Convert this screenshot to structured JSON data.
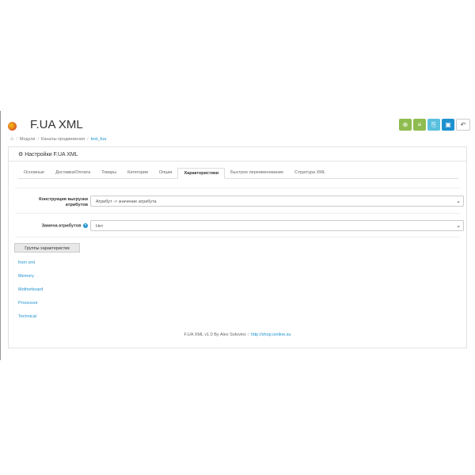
{
  "header": {
    "title": "F.UA XML",
    "buttons": [
      {
        "name": "add",
        "glyph": "⊕",
        "color": "#8fbc50"
      },
      {
        "name": "list",
        "glyph": "≡",
        "color": "#8fbc50"
      },
      {
        "name": "export",
        "glyph": "⎘",
        "color": "#5bc0de"
      },
      {
        "name": "save",
        "glyph": "▣",
        "color": "#1e91cf"
      },
      {
        "name": "back",
        "glyph": "↶",
        "color": "#ffffff"
      }
    ]
  },
  "breadcrumb": {
    "items": [
      "Модули",
      "Каналы продвижения",
      "test_fua"
    ]
  },
  "panel": {
    "heading": "Настройки F.UA XML"
  },
  "tabs": [
    "Основные",
    "Доставка/Оплата",
    "Товары",
    "Категории",
    "Опции",
    "Характеристики",
    "Быстрое переименование",
    "Структура XML"
  ],
  "active_tab": "Характеристики",
  "form": {
    "construction_label": "Конструкция выгрузки атрибутов",
    "construction_value": "Атрибут -> значение атрибута",
    "replace_label": "Замена атрибутов",
    "replace_value": "Нет"
  },
  "groups": {
    "button": "Группы характеристик",
    "items": [
      "from xml",
      "Memory",
      "Motherboard",
      "Processor",
      "Technical"
    ]
  },
  "footer": {
    "text": "F.UA XML v1.0 By Alex Soloviov :: ",
    "link": "http://shop.ionline.su"
  },
  "icons": {
    "home": "home-icon",
    "settings": "gear-icon",
    "help": "question-circle-icon",
    "dropdown": "chevron-down-icon"
  }
}
